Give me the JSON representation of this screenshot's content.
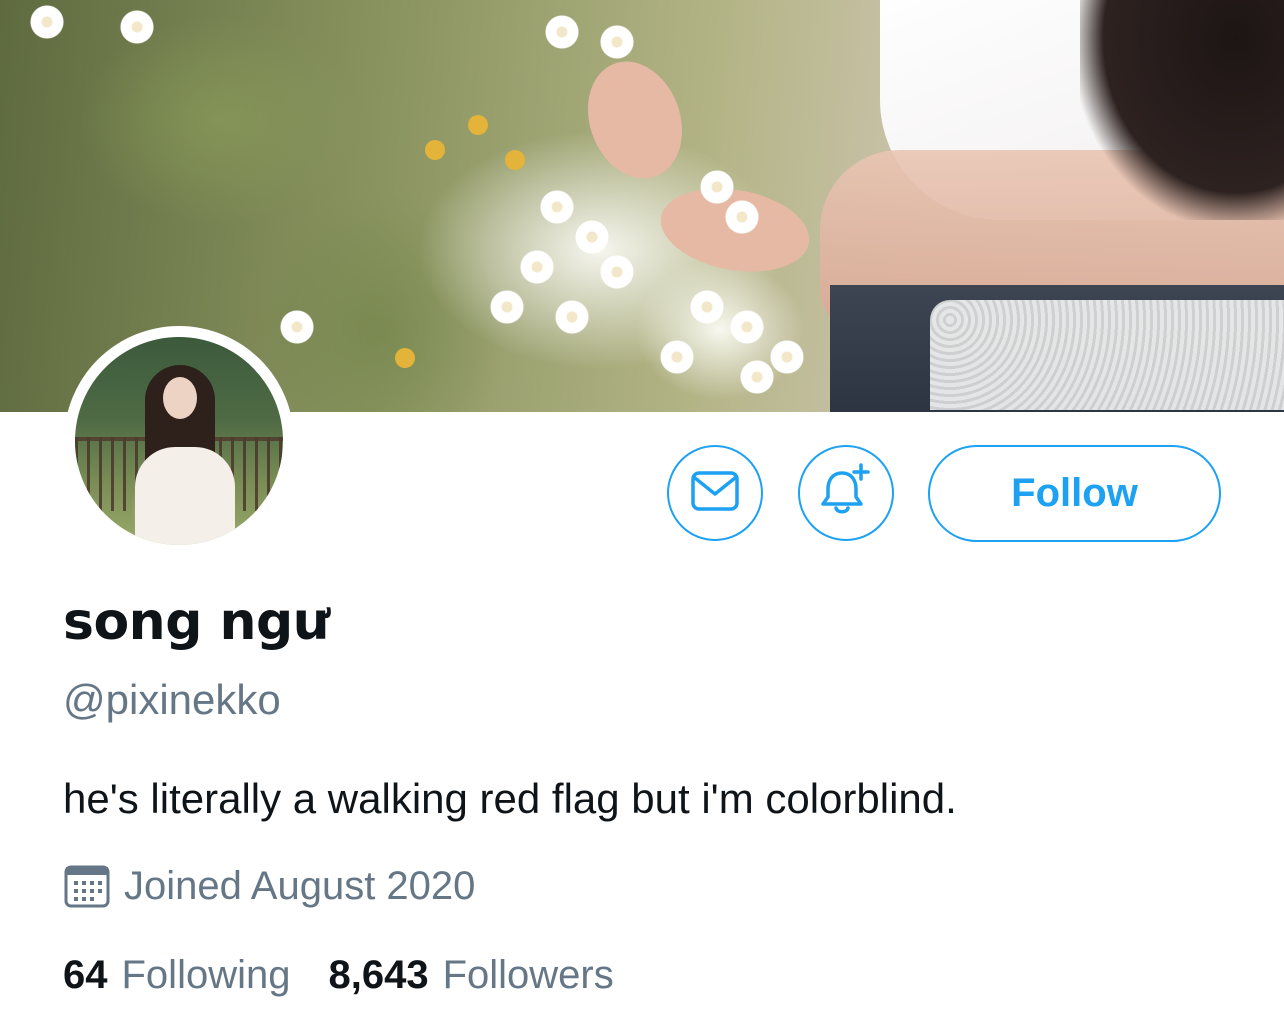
{
  "profile": {
    "display_name": "song ngư",
    "handle": "@pixinekko",
    "bio": "he's literally a walking red flag but i'm colorblind.",
    "joined": "Joined August 2020"
  },
  "actions": {
    "follow_label": "Follow",
    "message_icon": "envelope-icon",
    "notify_icon": "bell-plus-icon"
  },
  "stats": {
    "following_count": "64",
    "following_label": "Following",
    "followers_count": "8,643",
    "followers_label": "Followers"
  },
  "icons": {
    "joined": "calendar-icon"
  },
  "colors": {
    "accent": "#1da1f2",
    "primary_text": "#0f1419",
    "secondary_text": "#657786",
    "background": "#ffffff"
  }
}
